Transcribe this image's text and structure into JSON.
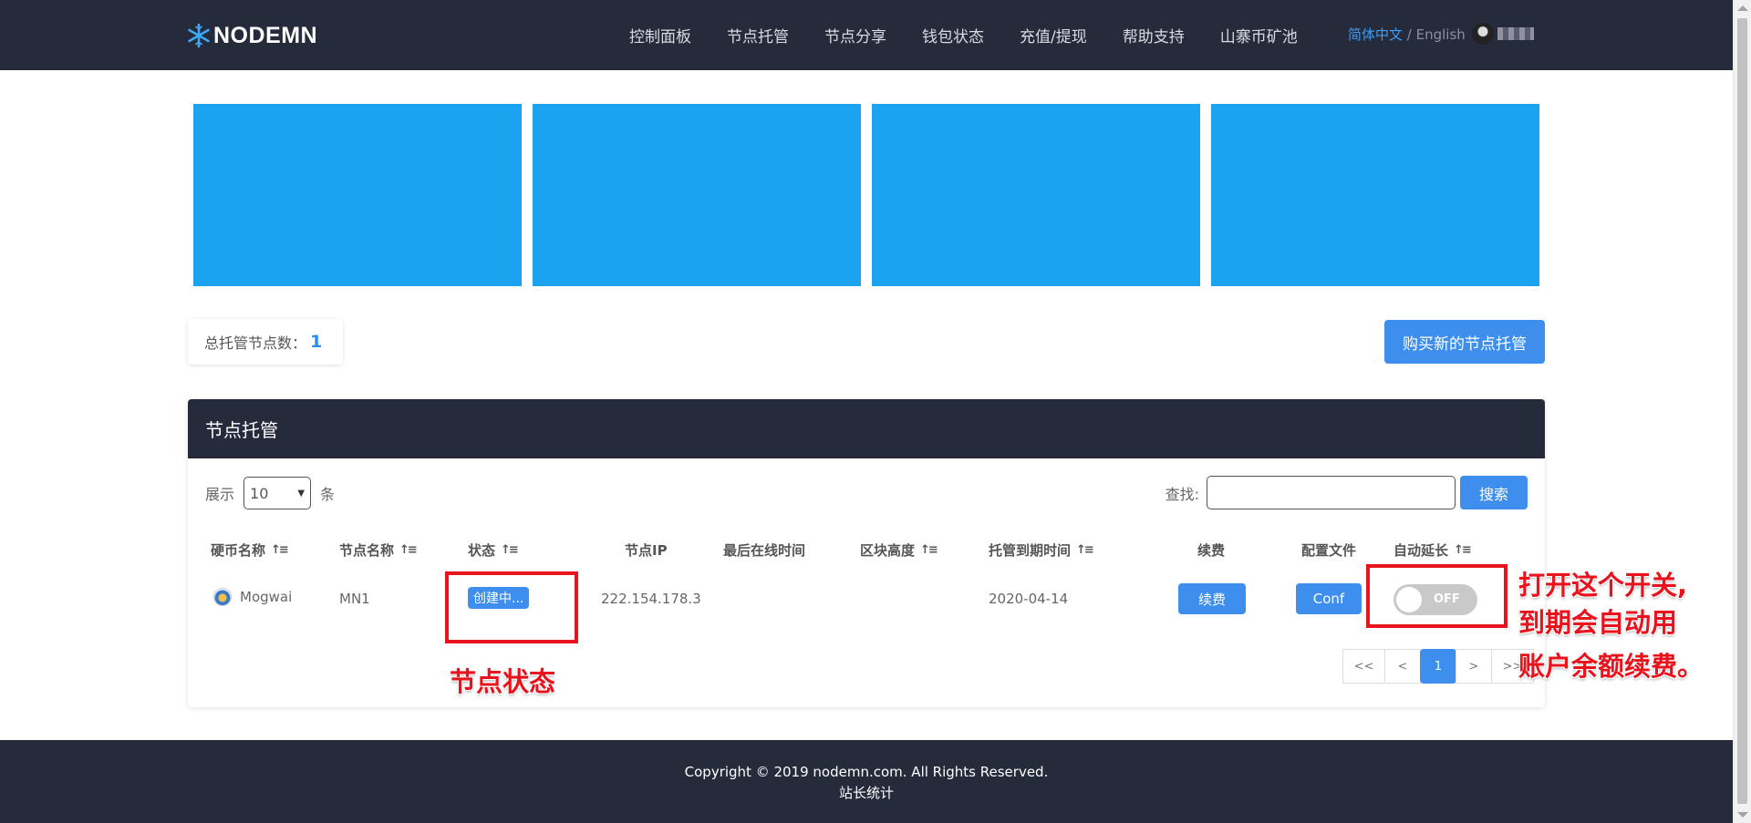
{
  "brand": {
    "logo_text": "NODEMN"
  },
  "nav": [
    "控制面板",
    "节点托管",
    "节点分享",
    "钱包状态",
    "充值/提现",
    "帮助支持",
    "山寨币矿池"
  ],
  "lang": {
    "active": "简体中文",
    "separator": " / ",
    "other": "English"
  },
  "stats": {
    "total_label": "总托管节点数：",
    "total_value": "1"
  },
  "buy_button": "购买新的节点托管",
  "panel": {
    "title": "节点托管",
    "show_label": "展示",
    "show_value": "10",
    "show_unit": "条",
    "search_label": "查找:",
    "search_placeholder": "",
    "search_button": "搜索",
    "columns": [
      "硬币名称",
      "节点名称",
      "状态",
      "节点IP",
      "最后在线时间",
      "区块高度",
      "托管到期时间",
      "续费",
      "配置文件",
      "自动延长"
    ],
    "rows": [
      {
        "coin": "Mogwai",
        "node_name": "MN1",
        "status": "创建中...",
        "ip": "222.154.178.3",
        "last_online": "",
        "block_height": "",
        "expires": "2020-04-14",
        "renew_label": "续费",
        "conf_label": "Conf",
        "auto_renew": "OFF"
      }
    ],
    "pagination": [
      "<<",
      "<",
      "1",
      ">",
      ">>"
    ]
  },
  "annotations": {
    "status_note": "节点状态",
    "toggle_note": [
      "打开这个开关,",
      "到期会自动用",
      "账户余额续费。"
    ],
    "color": "#e8131d"
  },
  "footer": {
    "copyright": "Copyright © 2019 nodemn.com. All Rights Reserved.",
    "stats_link": "站长统计"
  },
  "colors": {
    "header_bg": "#252b3b",
    "accent": "#3d8eed",
    "banner": "#1ba3ef"
  }
}
